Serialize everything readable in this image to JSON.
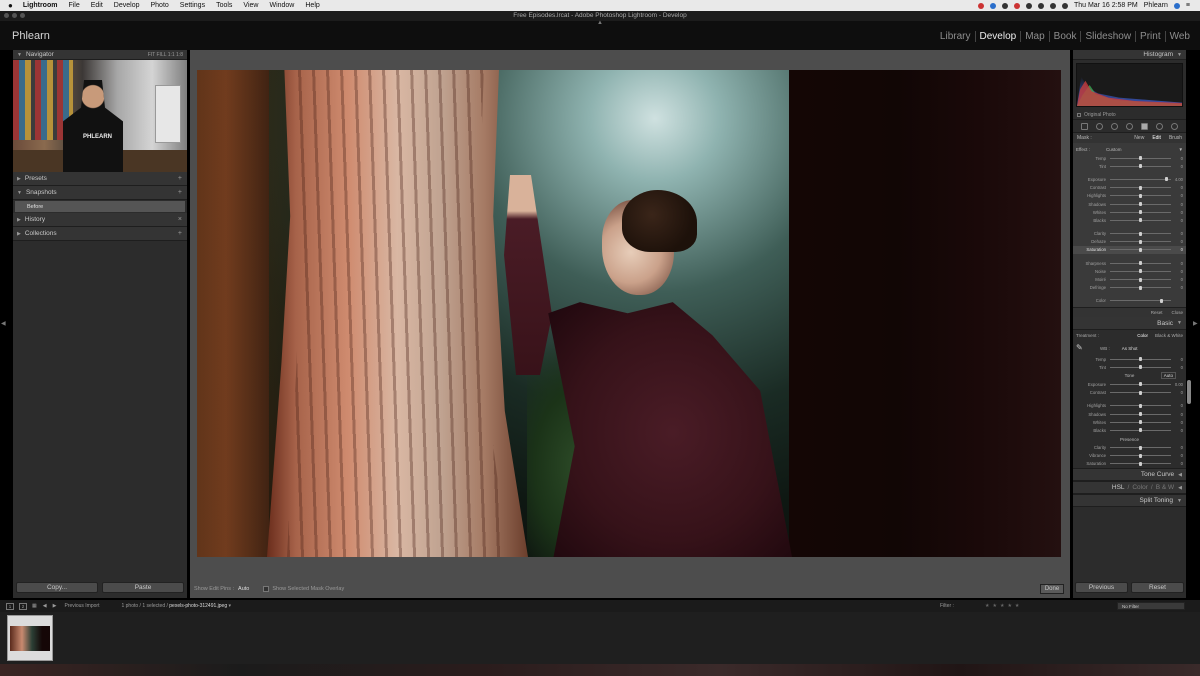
{
  "menubar": {
    "apple": "",
    "items": [
      "Lightroom",
      "File",
      "Edit",
      "Develop",
      "Photo",
      "Settings",
      "Tools",
      "View",
      "Window",
      "Help"
    ],
    "clock": "Thu Mar 16  2:58 PM",
    "user": "Phlearn"
  },
  "window": {
    "title": "Free Episodes.lrcat - Adobe Photoshop Lightroom - Develop"
  },
  "topbar": {
    "brand": "Phlearn",
    "modules": [
      "Library",
      "Develop",
      "Map",
      "Book",
      "Slideshow",
      "Print",
      "Web"
    ],
    "active_module": "Develop"
  },
  "left": {
    "navigator": {
      "label": "Navigator",
      "zoom": "FIT   FILL   1:1   1:8",
      "preview_text": "PHLEARN"
    },
    "presets": "Presets",
    "snapshots": {
      "label": "Snapshots",
      "items": [
        "Before"
      ]
    },
    "history": "History",
    "collections": "Collections",
    "copy_button": "Copy...",
    "paste_button": "Paste"
  },
  "toolbar": {
    "show_edit_pins_label": "Show Edit Pins :",
    "show_edit_pins_value": "Auto",
    "overlay_label": "Show Selected Mask Overlay",
    "done_button": "Done"
  },
  "right": {
    "histogram_label": "Histogram",
    "original_photo": "Original Photo",
    "mask": {
      "label": "Mask :",
      "options": [
        "New",
        "Edit",
        "Brush"
      ],
      "active": "Edit"
    },
    "effect": {
      "label": "Effect :",
      "value": "Custom"
    },
    "local_sliders": [
      {
        "name": "Temp",
        "pos": 0.5,
        "value": "0"
      },
      {
        "name": "Tint",
        "pos": 0.5,
        "value": "0"
      },
      {
        "gap": true
      },
      {
        "name": "Exposure",
        "pos": 0.92,
        "value": "4.00"
      },
      {
        "name": "Contrast",
        "pos": 0.5,
        "value": "0"
      },
      {
        "name": "Highlights",
        "pos": 0.5,
        "value": "0"
      },
      {
        "name": "Shadows",
        "pos": 0.5,
        "value": "0"
      },
      {
        "name": "Whites",
        "pos": 0.5,
        "value": "0"
      },
      {
        "name": "Blacks",
        "pos": 0.5,
        "value": "0"
      },
      {
        "gap": true
      },
      {
        "name": "Clarity",
        "pos": 0.5,
        "value": "0"
      },
      {
        "name": "Dehaze",
        "pos": 0.5,
        "value": "0"
      },
      {
        "name": "Saturation",
        "pos": 0.5,
        "value": "0",
        "highlight": true
      },
      {
        "gap": true
      },
      {
        "name": "Sharpness",
        "pos": 0.5,
        "value": "0"
      },
      {
        "name": "Noise",
        "pos": 0.5,
        "value": "0"
      },
      {
        "name": "Moiré",
        "pos": 0.5,
        "value": "0"
      },
      {
        "name": "Defringe",
        "pos": 0.5,
        "value": "0"
      },
      {
        "gap": true
      },
      {
        "name": "Color",
        "pos": 0.85,
        "value": ""
      }
    ],
    "reset": "Reset",
    "close": "Close",
    "basic": {
      "label": "Basic",
      "treatment_label": "Treatment :",
      "treatment_options": [
        "Color",
        "Black & White"
      ],
      "treatment_active": "Color",
      "wb_label": "WB :",
      "wb_value": "As Shot",
      "wb_sliders": [
        {
          "name": "Temp",
          "pos": 0.5,
          "value": "0"
        },
        {
          "name": "Tint",
          "pos": 0.5,
          "value": "0"
        }
      ],
      "tone_label": "Tone",
      "auto": "Auto",
      "tone_sliders": [
        {
          "name": "Exposure",
          "pos": 0.5,
          "value": "0.00"
        },
        {
          "name": "Contrast",
          "pos": 0.5,
          "value": "0"
        },
        {
          "gap": true
        },
        {
          "name": "Highlights",
          "pos": 0.5,
          "value": "0"
        },
        {
          "name": "Shadows",
          "pos": 0.5,
          "value": "0"
        },
        {
          "name": "Whites",
          "pos": 0.5,
          "value": "0"
        },
        {
          "name": "Blacks",
          "pos": 0.5,
          "value": "0"
        }
      ],
      "presence_label": "Presence",
      "presence_sliders": [
        {
          "name": "Clarity",
          "pos": 0.5,
          "value": "0"
        },
        {
          "name": "Vibrance",
          "pos": 0.5,
          "value": "0"
        },
        {
          "name": "Saturation",
          "pos": 0.5,
          "value": "0"
        }
      ]
    },
    "tone_curve": "Tone Curve",
    "hsl": {
      "hsl": "HSL",
      "color": "Color",
      "bw": "B & W",
      "sep": "/"
    },
    "split_toning": "Split Toning",
    "previous_button": "Previous",
    "reset_button": "Reset"
  },
  "filmbar": {
    "screens": [
      "1",
      "2"
    ],
    "source": "Previous Import",
    "info_prefix": "1 photo / 1 selected /",
    "filename": "pexels-photo-312491.jpeg",
    "filter_label": "Filter :",
    "stars": "★★★★★",
    "filter_value": "No Filter"
  }
}
